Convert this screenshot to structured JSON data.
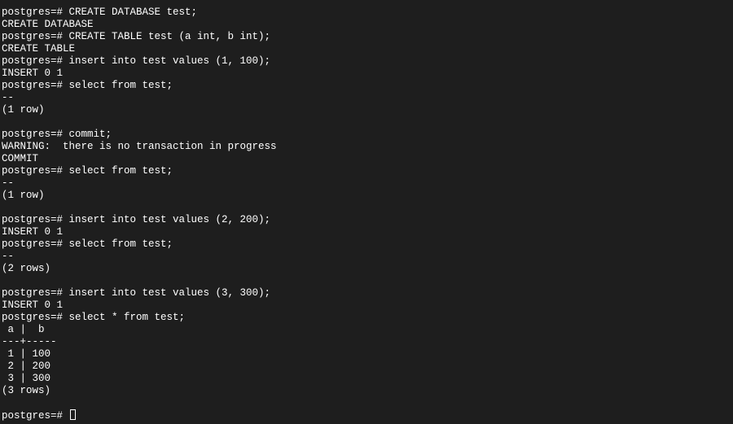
{
  "terminal": {
    "lines": [
      "postgres=# CREATE DATABASE test;",
      "CREATE DATABASE",
      "postgres=# CREATE TABLE test (a int, b int);",
      "CREATE TABLE",
      "postgres=# insert into test values (1, 100);",
      "INSERT 0 1",
      "postgres=# select from test;",
      "--",
      "(1 row)",
      "",
      "postgres=# commit;",
      "WARNING:  there is no transaction in progress",
      "COMMIT",
      "postgres=# select from test;",
      "--",
      "(1 row)",
      "",
      "postgres=# insert into test values (2, 200);",
      "INSERT 0 1",
      "postgres=# select from test;",
      "--",
      "(2 rows)",
      "",
      "postgres=# insert into test values (3, 300);",
      "INSERT 0 1",
      "postgres=# select * from test;",
      " a |  b",
      "---+-----",
      " 1 | 100",
      " 2 | 200",
      " 3 | 300",
      "(3 rows)",
      ""
    ],
    "prompt": "postgres=# ",
    "colors": {
      "background": "#1e1e1e",
      "foreground": "#ffffff"
    }
  }
}
